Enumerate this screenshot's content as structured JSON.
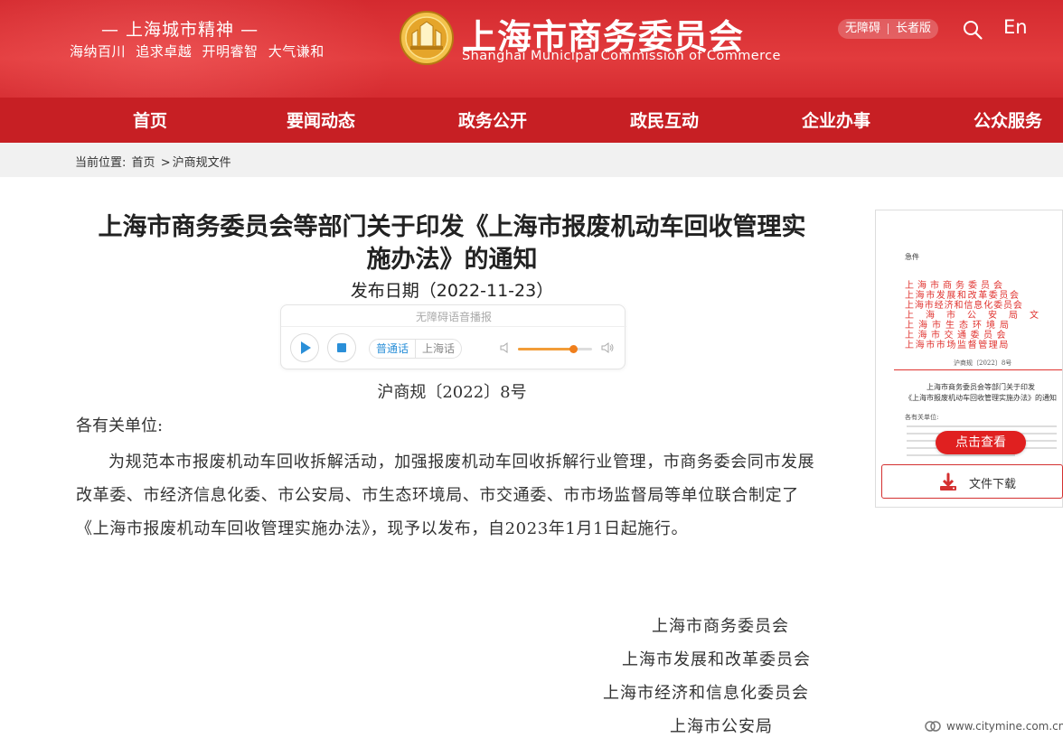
{
  "header": {
    "motto_title": "— 上海城市精神 —",
    "motto_sub": "海纳百川  追求卓越  开明睿智  大气谦和",
    "site_title": "上海市商务委员会",
    "site_subtitle": "Shanghai Municipal Commission of Commerce",
    "accessibility_label": "无障碍",
    "elderly_label": "长者版",
    "language_label": "En",
    "brand_color": "#d52b30"
  },
  "nav": {
    "items": [
      "首页",
      "要闻动态",
      "政务公开",
      "政民互动",
      "企业办事",
      "公众服务"
    ]
  },
  "breadcrumb": {
    "prefix": "当前位置:",
    "home": "首页",
    "separator": ">",
    "current": "沪商规文件"
  },
  "article": {
    "title_line1": "上海市商务委员会等部门关于印发《上海市报废机动车回收管理实",
    "title_line2": "施办法》的通知",
    "publish_date": "发布日期（2022-11-23）",
    "doc_number": "沪商规〔2022〕8号",
    "salutation": "各有关单位:",
    "body": "为规范本市报废机动车回收拆解活动，加强报废机动车回收拆解行业管理，市商务委会同市发展改革委、市经济信息化委、市公安局、市生态环境局、市交通委、市市场监督局等单位联合制定了《上海市报废机动车回收管理实施办法》，现予以发布，自2023年1月1日起施行。",
    "signatories": [
      "上海市商务委员会",
      "上海市发展和改革委员会",
      "上海市经济和信息化委员会",
      "上海市公安局"
    ]
  },
  "player": {
    "title": "无障碍语音播报",
    "dialect_mandarin": "普通话",
    "dialect_shanghai": "上海话",
    "volume_level": 0.75,
    "accent_color": "#f07f1c"
  },
  "preview": {
    "tag": "急件",
    "issuers": [
      "上海市商务委员会",
      "上海市发展和改革委员会",
      "上海市经济和信息化委员会",
      "上海市公安局文",
      "上海市生态环境局",
      "上海市交通委员会",
      "上海市市场监督管理局"
    ],
    "doc_number": "沪商规〔2022〕8号",
    "title_line1": "上海市商务委员会等部门关于印发",
    "title_line2": "《上海市报废机动车回收管理实施办法》的通知",
    "salutation": "各有关单位:",
    "view_button": "点击查看",
    "download_button": "文件下载"
  },
  "watermark": {
    "text": "www.citymine.com.cn"
  }
}
